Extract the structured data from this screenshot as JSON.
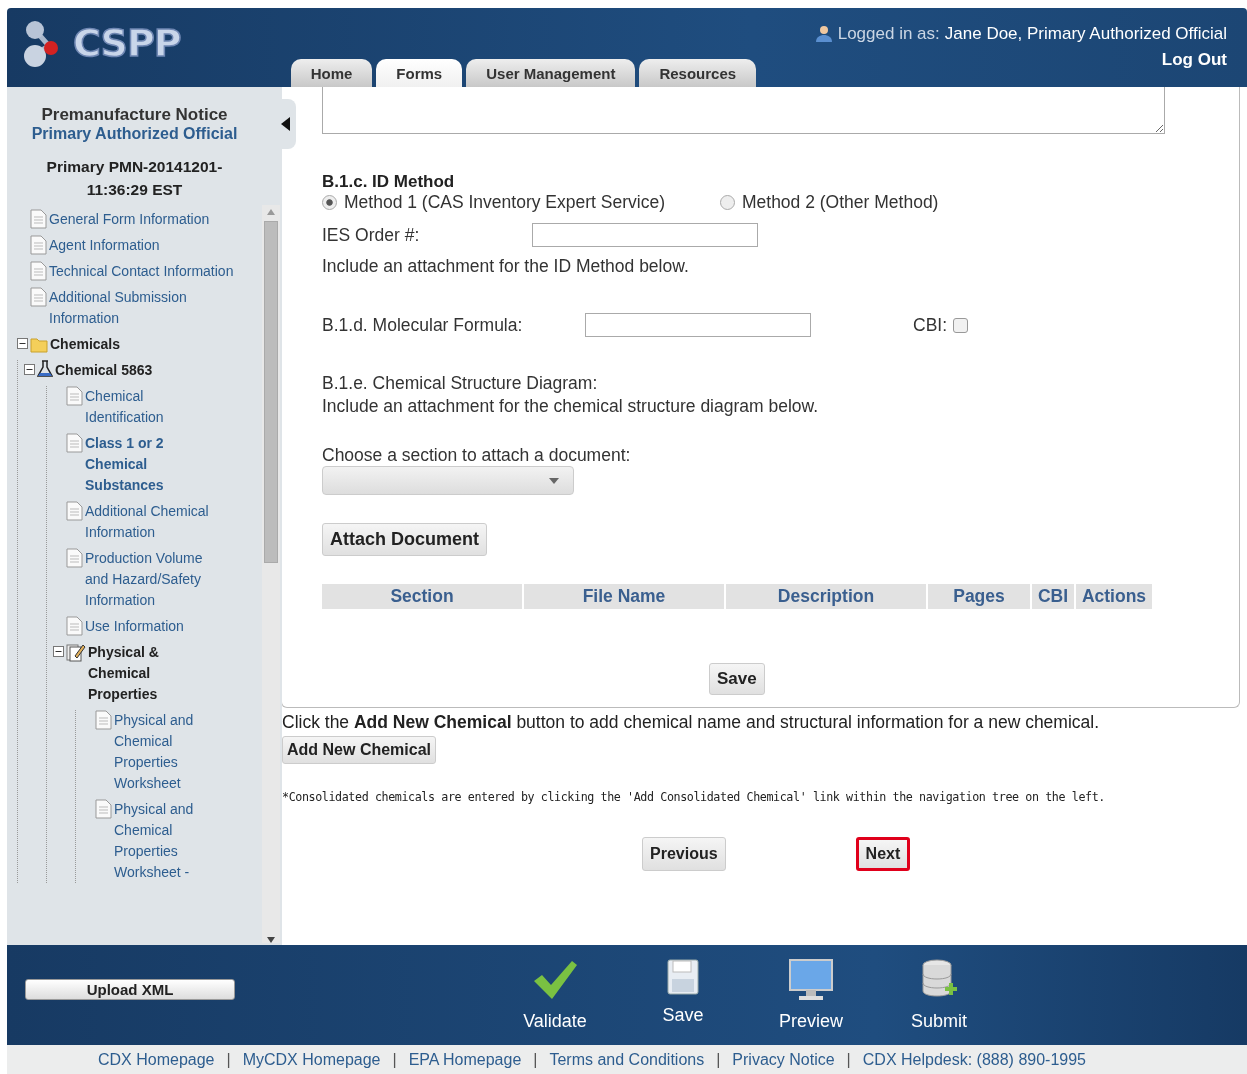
{
  "header": {
    "logo": "CSPP",
    "login_label": "Logged in as:",
    "login_user": "Jane Doe, Primary Authorized Official",
    "logout": "Log Out"
  },
  "tabs": [
    {
      "label": "Home",
      "selected": false
    },
    {
      "label": "Forms",
      "selected": true
    },
    {
      "label": "User Management",
      "selected": false
    },
    {
      "label": "Resources",
      "selected": false
    }
  ],
  "sidebar": {
    "title": "Premanufacture Notice",
    "role": "Primary Authorized Official",
    "submission": "Primary PMN-20141201-11:36:29 EST",
    "tree": [
      {
        "kind": "doc",
        "label": "General Form Information",
        "bold": false
      },
      {
        "kind": "doc",
        "label": "Agent Information",
        "bold": false
      },
      {
        "kind": "doc",
        "label": "Technical Contact Information",
        "bold": false
      },
      {
        "kind": "doc",
        "label": "Additional Submission Information",
        "bold": false
      },
      {
        "kind": "folder",
        "label": "Chemicals",
        "bold": true,
        "expanded": true,
        "children": [
          {
            "kind": "flask",
            "label": "Chemical 5863",
            "bold": true,
            "expanded": true,
            "children": [
              {
                "kind": "doc",
                "label": "Chemical Identification",
                "bold": false
              },
              {
                "kind": "doc",
                "label": "Class 1 or 2 Chemical Substances",
                "bold": true
              },
              {
                "kind": "doc",
                "label": "Additional Chemical Information",
                "bold": false
              },
              {
                "kind": "doc",
                "label": "Production Volume and Hazard/Safety Information",
                "bold": false
              },
              {
                "kind": "doc",
                "label": "Use Information",
                "bold": false
              },
              {
                "kind": "properties",
                "label": "Physical & Chemical Properties",
                "bold": true,
                "expanded": true,
                "children": [
                  {
                    "kind": "doc",
                    "label": "Physical and Chemical Properties Worksheet",
                    "bold": false
                  },
                  {
                    "kind": "doc",
                    "label": "Physical and Chemical Properties Worksheet -",
                    "bold": false
                  }
                ]
              }
            ]
          }
        ]
      }
    ]
  },
  "form": {
    "id_method": {
      "title": "B.1.c. ID Method",
      "options": [
        {
          "label": "Method 1 (CAS Inventory Expert Service)",
          "selected": true
        },
        {
          "label": "Method 2 (Other Method)",
          "selected": false
        }
      ]
    },
    "ies_label": "IES Order #:",
    "id_note": "Include an attachment for the ID Method below.",
    "formula_label": "B.1.d. Molecular Formula:",
    "cbi": {
      "label": "CBI:",
      "checked": false
    },
    "structure_title": "B.1.e. Chemical Structure Diagram:",
    "structure_note": "Include an attachment for the chemical structure diagram below.",
    "choose_label": "Choose a section to attach a document:",
    "attach_button": "Attach Document",
    "columns": [
      "Section",
      "File Name",
      "Description",
      "Pages",
      "CBI",
      "Actions"
    ],
    "save": "Save"
  },
  "add_note": "Click the **Add New Chemical** button to add chemical name and structural information for a new chemical.",
  "add_button": "Add New Chemical",
  "consolidated_note": "*Consolidated chemicals are entered by clicking the 'Add Consolidated Chemical' link within the navigation tree on the left.",
  "nav": [
    {
      "label": "Previous",
      "highlighted": false
    },
    {
      "label": "Next",
      "highlighted": true
    }
  ],
  "toolbar": {
    "upload": "Upload XML",
    "actions": [
      {
        "kind": "validate",
        "label": "Validate"
      },
      {
        "kind": "save",
        "label": "Save"
      },
      {
        "kind": "preview",
        "label": "Preview"
      },
      {
        "kind": "submit",
        "label": "Submit"
      }
    ]
  },
  "footer_separator": "|",
  "footer_links": [
    "CDX Homepage",
    "MyCDX Homepage",
    "EPA Homepage",
    "Terms and Conditions",
    "Privacy Notice",
    "CDX Helpdesk: (888) 890-1995"
  ]
}
